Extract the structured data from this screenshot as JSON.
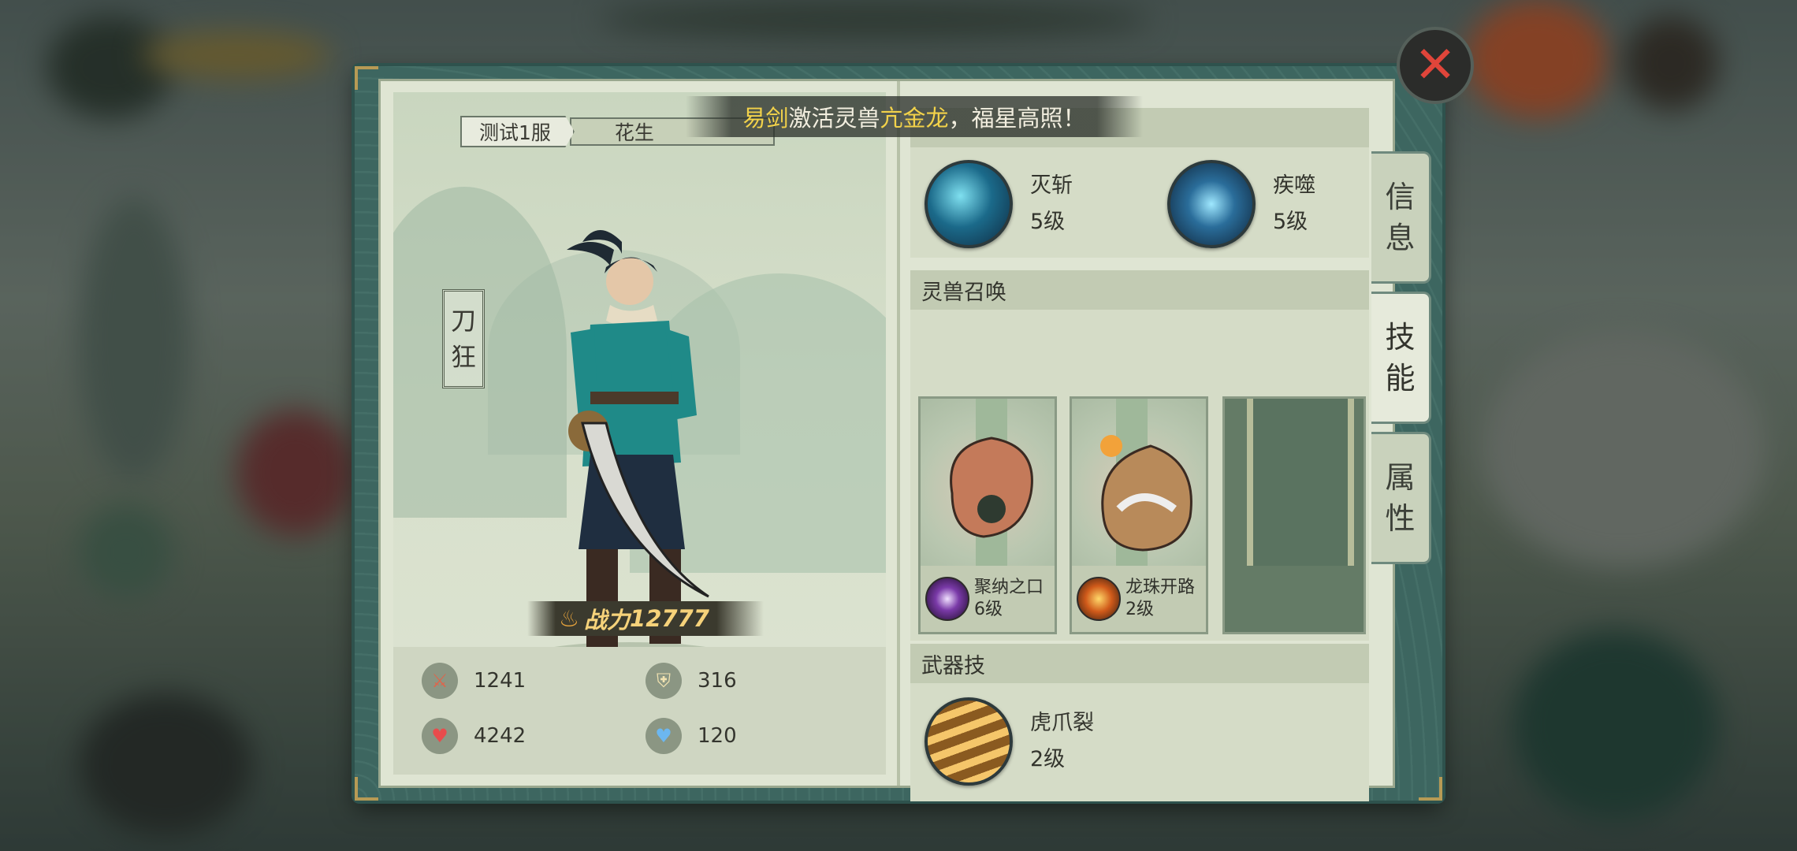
{
  "header": {
    "server": "测试1服",
    "player_name": "花生"
  },
  "broadcast": {
    "player": "易剑",
    "verb": "激活灵兽",
    "beast": "亢金龙",
    "tail": "，福星高照！"
  },
  "character": {
    "title": "刀狂",
    "power_label": "战力",
    "power_value": "12777"
  },
  "stats": [
    {
      "icon": "sword-icon",
      "value": "1241"
    },
    {
      "icon": "shield-icon",
      "value": "316"
    },
    {
      "icon": "heart-icon",
      "value": "4242"
    },
    {
      "icon": "mana-icon",
      "value": "120"
    }
  ],
  "skills": [
    {
      "name": "灭斩",
      "level": "5级",
      "icon": "crescent-slash-icon"
    },
    {
      "name": "疾噬",
      "level": "5级",
      "icon": "lightning-bite-icon"
    }
  ],
  "beast_section": {
    "title": "灵兽召唤"
  },
  "beasts": [
    {
      "skill": "聚纳之口",
      "level": "6级",
      "icon": "void-mouth-icon"
    },
    {
      "skill": "龙珠开路",
      "level": "2级",
      "icon": "dragon-pearl-icon"
    }
  ],
  "weapon_section": {
    "title": "武器技",
    "skill": "虎爪裂",
    "level": "2级"
  },
  "tabs": [
    {
      "label_1": "信",
      "label_2": "息",
      "active": false
    },
    {
      "label_1": "技",
      "label_2": "能",
      "active": true
    },
    {
      "label_1": "属",
      "label_2": "性",
      "active": false
    }
  ],
  "colors": {
    "accent_gold": "#f2d24a",
    "close_red": "#e0453a",
    "frame_teal": "#3d6660"
  }
}
